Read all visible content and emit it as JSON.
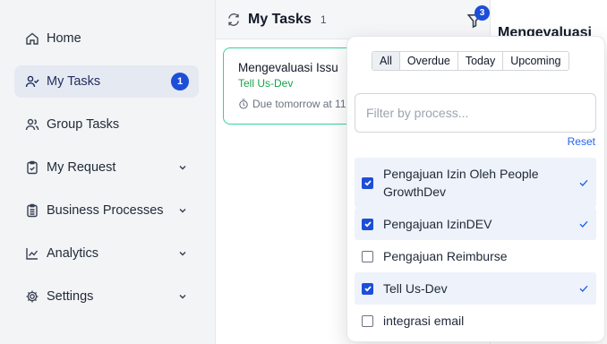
{
  "sidebar": {
    "items": [
      {
        "label": "Home",
        "icon": "home-icon"
      },
      {
        "label": "My Tasks",
        "icon": "user-check-icon",
        "badge": "1",
        "active": true
      },
      {
        "label": "Group Tasks",
        "icon": "users-icon"
      },
      {
        "label": "My Request",
        "icon": "clipboard-check-icon",
        "expandable": true
      },
      {
        "label": "Business Processes",
        "icon": "clipboard-list-icon",
        "expandable": true
      },
      {
        "label": "Analytics",
        "icon": "chart-line-icon",
        "expandable": true
      },
      {
        "label": "Settings",
        "icon": "gear-icon",
        "expandable": true
      }
    ]
  },
  "tasks": {
    "title": "My Tasks",
    "count": "1",
    "filter_badge": "3",
    "card": {
      "title": "Mengevaluasi Issu",
      "process": "Tell Us-Dev",
      "due": "Due tomorrow at 11"
    }
  },
  "detail": {
    "title": "Mengevaluasi"
  },
  "filter_popover": {
    "segments": [
      "All",
      "Overdue",
      "Today",
      "Upcoming"
    ],
    "selected_segment": "All",
    "search_placeholder": "Filter by process...",
    "reset_label": "Reset",
    "options": [
      {
        "label": "Pengajuan Izin Oleh People GrowthDev",
        "checked": true
      },
      {
        "label": "Pengajuan IzinDEV",
        "checked": true
      },
      {
        "label": "Pengajuan Reimburse",
        "checked": false
      },
      {
        "label": "Tell Us-Dev",
        "checked": true
      },
      {
        "label": "integrasi email",
        "checked": false
      }
    ]
  },
  "colors": {
    "accent": "#1d4ed8",
    "card_border": "#34d399",
    "process_text": "#16a34a",
    "link": "#2563eb"
  }
}
